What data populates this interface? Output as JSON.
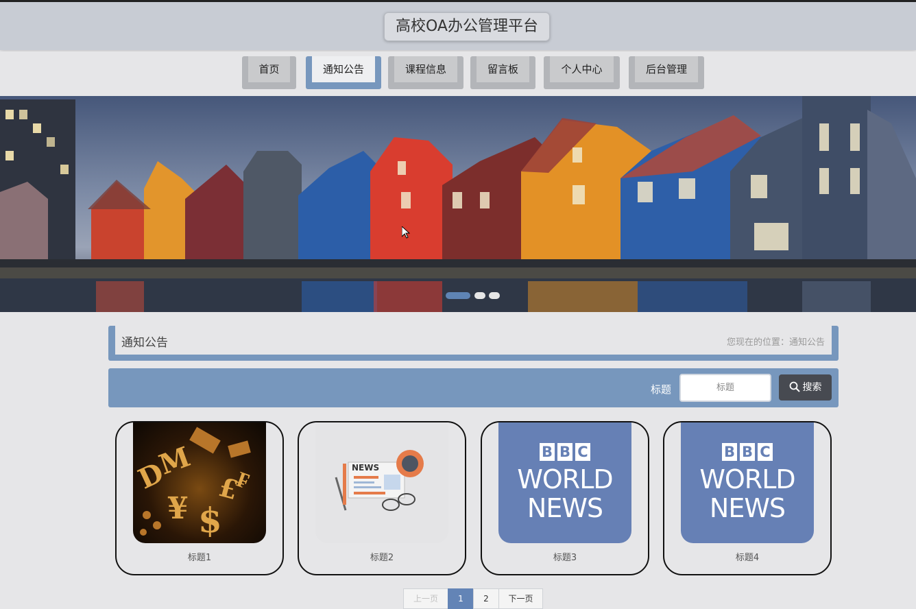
{
  "header": {
    "title": "高校OA办公管理平台"
  },
  "nav": {
    "items": [
      {
        "label": "首页"
      },
      {
        "label": "通知公告"
      },
      {
        "label": "课程信息"
      },
      {
        "label": "留言板"
      },
      {
        "label": "个人中心"
      },
      {
        "label": "后台管理"
      }
    ],
    "active_index": 1
  },
  "banner": {
    "slide_count": 3,
    "active_slide": 0
  },
  "breadcrumb": {
    "title": "通知公告",
    "position_text": "您现在的位置：通知公告"
  },
  "search": {
    "label": "标题",
    "placeholder": "标题",
    "button_label": "搜索"
  },
  "cards": [
    {
      "title": "标题1",
      "image": "finance-symbols-image"
    },
    {
      "title": "标题2",
      "image": "news-illustration-image"
    },
    {
      "title": "标题3",
      "image": "bbc-world-news-logo",
      "logo_letters": [
        "B",
        "B",
        "C"
      ],
      "logo_line1": "WORLD",
      "logo_line2": "NEWS"
    },
    {
      "title": "标题4",
      "image": "bbc-world-news-logo",
      "logo_letters": [
        "B",
        "B",
        "C"
      ],
      "logo_line1": "WORLD",
      "logo_line2": "NEWS"
    }
  ],
  "pagination": {
    "prev_label": "上一页",
    "pages": [
      "1",
      "2"
    ],
    "current": "1",
    "next_label": "下一页"
  },
  "colors": {
    "accent": "#7797bd",
    "header_bg": "#c8ccd4",
    "page_bg": "#e6e6e8",
    "button_dark": "#474a51"
  }
}
